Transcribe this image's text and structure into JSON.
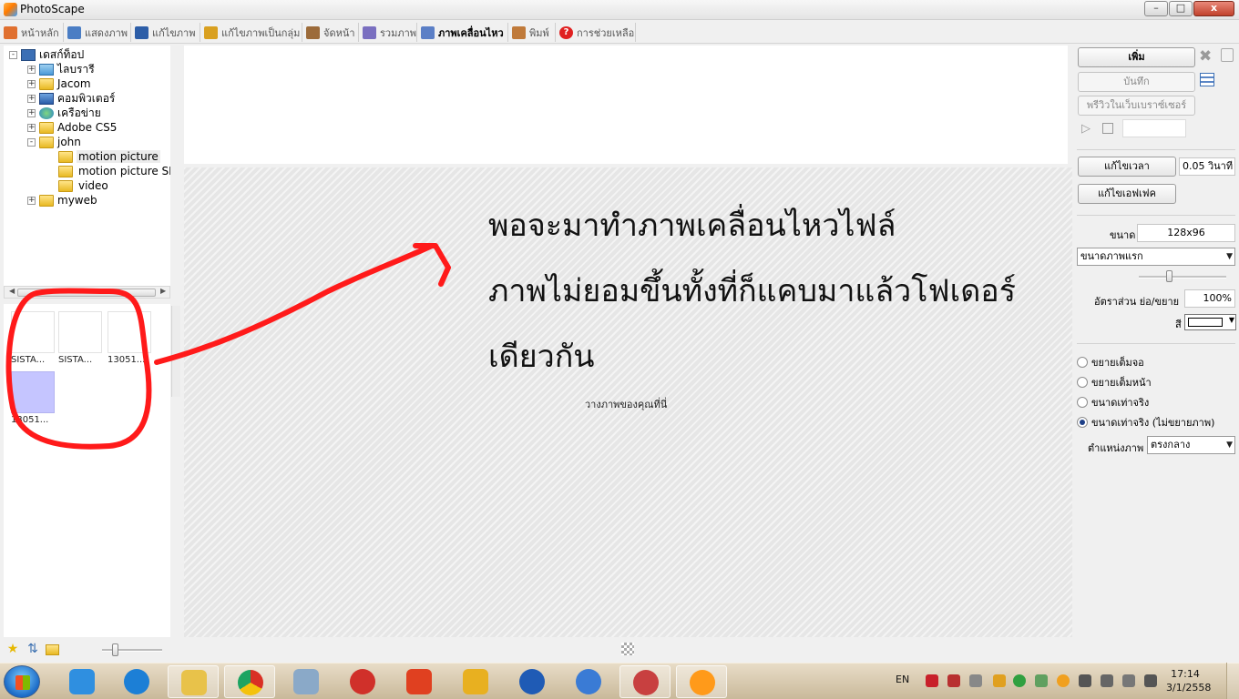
{
  "window": {
    "title": "PhotoScape",
    "controls": {
      "minimize": "–",
      "maximize": "□",
      "close": "x"
    }
  },
  "tabs": [
    {
      "label": "หน้าหลัก",
      "icon": "photoscape-home-icon",
      "color": "#e07030"
    },
    {
      "label": "แสดงภาพ",
      "icon": "viewer-icon",
      "color": "#4a7dc4"
    },
    {
      "label": "แก้ไขภาพ",
      "icon": "editor-icon",
      "color": "#2d5ea8"
    },
    {
      "label": "แก้ไขภาพเป็นกลุ่ม",
      "icon": "batch-editor-icon",
      "color": "#d9a020"
    },
    {
      "label": "จัดหน้า",
      "icon": "page-layout-icon",
      "color": "#9c6b3a"
    },
    {
      "label": "รวมภาพ",
      "icon": "combine-icon",
      "color": "#7a6fc0"
    },
    {
      "label": "ภาพเคลื่อนไหว",
      "icon": "animated-gif-icon",
      "color": "#5b7fc6",
      "active": true
    },
    {
      "label": "พิมพ์",
      "icon": "print-icon",
      "color": "#c07a3a"
    },
    {
      "label": "การช่วยเหลือ",
      "icon": "help-icon",
      "color": "#e02020",
      "glyph": "?"
    }
  ],
  "tree": {
    "root": "เดสก์ท็อป",
    "items": [
      {
        "label": "ไลบรารี",
        "icon": "library-icon"
      },
      {
        "label": "Jacom",
        "icon": "user-folder-icon"
      },
      {
        "label": "คอมพิวเตอร์",
        "icon": "computer-icon"
      },
      {
        "label": "เครือข่าย",
        "icon": "network-icon"
      },
      {
        "label": "Adobe CS5",
        "icon": "folder-icon"
      },
      {
        "label": "john",
        "icon": "folder-icon"
      },
      {
        "label": "motion picture",
        "icon": "folder-icon"
      },
      {
        "label": "motion picture SIS",
        "icon": "folder-icon"
      },
      {
        "label": "video",
        "icon": "folder-icon"
      },
      {
        "label": "myweb",
        "icon": "folder-icon"
      }
    ]
  },
  "thumbnails": [
    {
      "label": "SISTA..."
    },
    {
      "label": "SISTA..."
    },
    {
      "label": "13051..."
    },
    {
      "label": "13051..."
    }
  ],
  "canvas": {
    "question_lines": [
      "พอจะมาทำภาพเคลื่อนไหวไฟล์",
      "ภาพไม่ยอมขึ้นทั้งที่ก็แคบมาแล้วโฟเดอร์",
      "เดียวกัน"
    ],
    "drop_hint": "วางภาพของคุณที่นี่",
    "annotation_color": "#ff1a1a"
  },
  "right_panel": {
    "add_button": "เพิ่ม",
    "save_button": "บันทึก",
    "preview_button": "พรีวิวในเว็บเบราซ์เซอร์",
    "edit_time_button": "แก้ไขเวลา",
    "time_value": "0.05 วินาที",
    "edit_effect_button": "แก้ไขเอฟเฟค",
    "size_label": "ขนาด",
    "size_value": "128x96",
    "size_select": "ขนาดภาพแรก",
    "ratio_label": "อัตราส่วน ย่อ/ขยาย",
    "ratio_value": "100%",
    "color_label": "สี",
    "radios": [
      {
        "label": "ขยายเต็มจอ",
        "checked": false
      },
      {
        "label": "ขยายเต็มหน้า",
        "checked": false
      },
      {
        "label": "ขนาดเท่าจริง",
        "checked": false
      },
      {
        "label": "ขนาดเท่าจริง (ไม่ขยายภาพ)",
        "checked": true
      }
    ],
    "position_label": "ตำแหน่งภาพ",
    "position_value": "ตรงกลาง"
  },
  "taskbar": {
    "apps": [
      {
        "name": "media-player-icon",
        "color": "#2f8fe0"
      },
      {
        "name": "internet-explorer-icon",
        "color": "#1c7fd6"
      },
      {
        "name": "file-explorer-icon",
        "color": "#e8c24a",
        "open": true
      },
      {
        "name": "chrome-icon",
        "color": "#d93025",
        "open": true
      },
      {
        "name": "calculator-icon",
        "color": "#8aa9c8"
      },
      {
        "name": "app-red-icon",
        "color": "#d0302a"
      },
      {
        "name": "app-k-icon",
        "color": "#e04020"
      },
      {
        "name": "tools-icon",
        "color": "#e8b020"
      },
      {
        "name": "firefox-icon",
        "color": "#1f5bb5"
      },
      {
        "name": "itunes-icon",
        "color": "#3a7bd5"
      },
      {
        "name": "app-gauge-icon",
        "color": "#c84040",
        "open": true
      },
      {
        "name": "photoscape-icon",
        "color": "#ff9a1a",
        "open": true
      }
    ],
    "language": "EN",
    "time": "17:14",
    "date": "3/1/2558"
  }
}
